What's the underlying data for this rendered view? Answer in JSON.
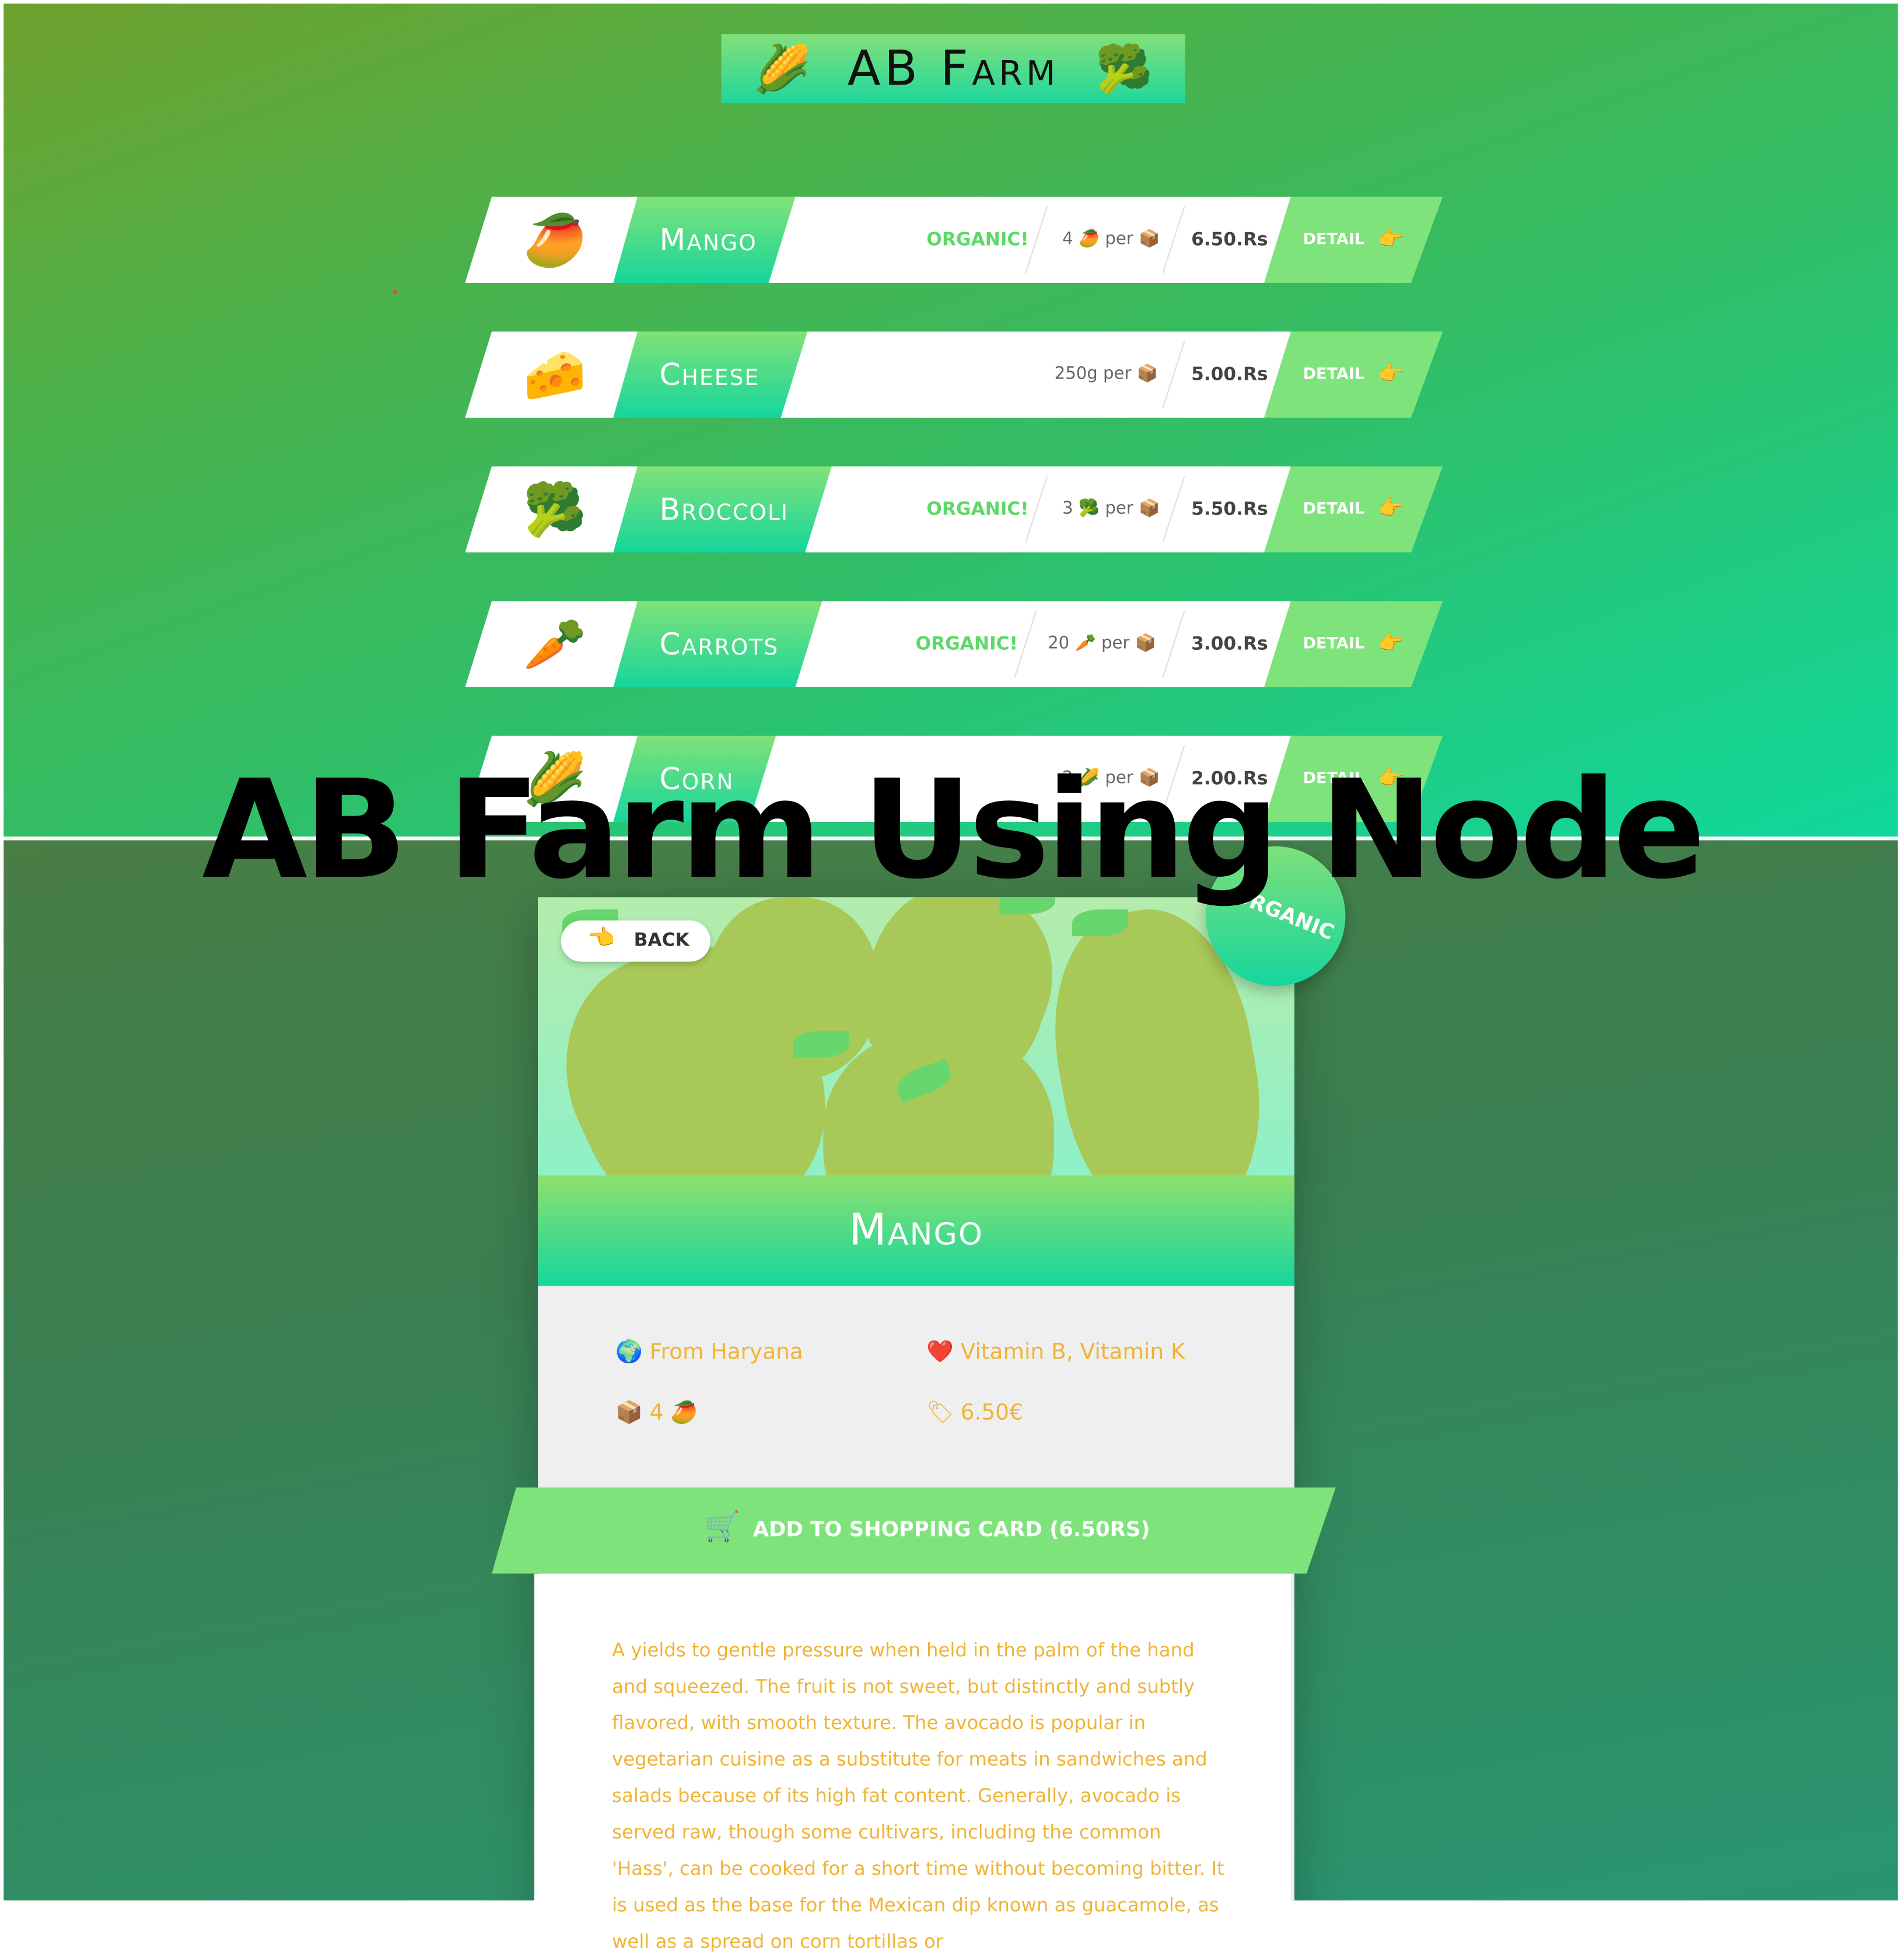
{
  "app": {
    "logo_title": "AB Farm",
    "logo_icon_left": "🌽",
    "logo_icon_right": "🥦"
  },
  "products": [
    {
      "name": "Mango",
      "image": "🥭",
      "organic": "ORGANIC!",
      "qty": "4 🥭 per 📦",
      "price": "6.50.Rs",
      "detail": "DETAIL",
      "detail_icon": "👉"
    },
    {
      "name": "Cheese",
      "image": "🧀",
      "organic": "",
      "qty": "250g per 📦",
      "price": "5.00.Rs",
      "detail": "DETAIL",
      "detail_icon": "👉"
    },
    {
      "name": "Broccoli",
      "image": "🥦",
      "organic": "ORGANIC!",
      "qty": "3 🥦 per 📦",
      "price": "5.50.Rs",
      "detail": "DETAIL",
      "detail_icon": "👉"
    },
    {
      "name": "Carrots",
      "image": "🥕",
      "organic": "ORGANIC!",
      "qty": "20 🥕 per 📦",
      "price": "3.00.Rs",
      "detail": "DETAIL",
      "detail_icon": "👉"
    },
    {
      "name": "Corn",
      "image": "🌽",
      "organic": "",
      "qty": "2 🌽 per 📦",
      "price": "2.00.Rs",
      "detail": "DETAIL",
      "detail_icon": "👉"
    }
  ],
  "headline": "AB Farm Using Node",
  "detail": {
    "back_label": "BACK",
    "back_icon": "👈",
    "organic_badge": "ORGANIC",
    "title": "Mango",
    "from": "From Haryana",
    "from_icon": "🌍",
    "vitamins": "Vitamin B, Vitamin K",
    "vitamins_icon": "❤️",
    "quantity": "4 🥭",
    "quantity_icon": "📦",
    "price": "6.50€",
    "price_icon": "🏷",
    "add_button": "ADD TO SHOPPING CARD (6.50RS)",
    "add_icon": "🛒",
    "description": "A yields to gentle pressure when held in the palm of the hand and squeezed. The fruit is not sweet, but distinctly and subtly flavored, with smooth texture. The avocado is popular in vegetarian cuisine as a substitute for meats in sandwiches and salads because of its high fat content. Generally, avocado is served raw, though some cultivars, including the common 'Hass', can be cooked for a short time without becoming bitter. It is used as the base for the Mexican dip known as guacamole, as well as a spread on corn tortillas or"
  },
  "colors": {
    "accent_green": "#7de37a",
    "gradient_teal": "#15d69d",
    "organic_text": "#5fd868",
    "description_text": "#f0b335"
  }
}
